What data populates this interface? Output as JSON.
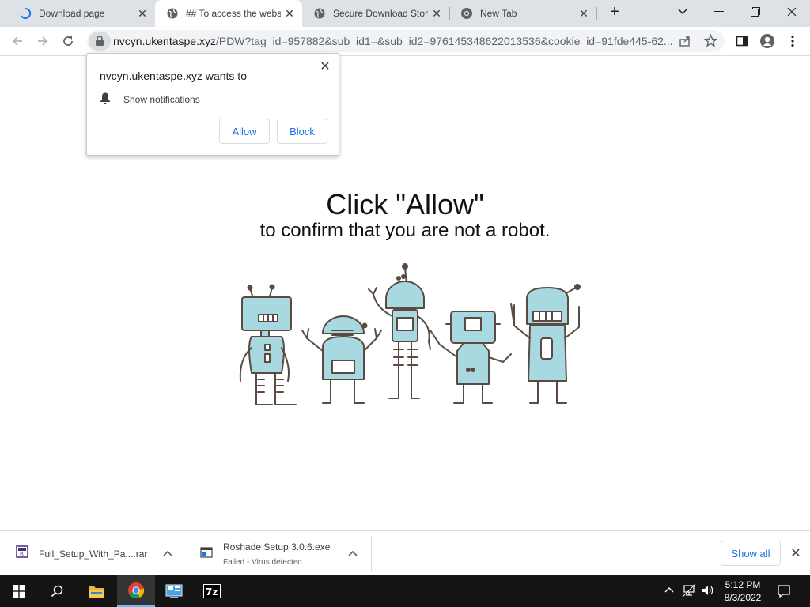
{
  "tabs": [
    {
      "title": "Download page",
      "icon": "loading-spinner-icon"
    },
    {
      "title": "## To access the websi",
      "icon": "globe-icon",
      "active": true
    },
    {
      "title": "Secure Download Store",
      "icon": "globe-icon"
    },
    {
      "title": "New Tab",
      "icon": "chrome-icon"
    }
  ],
  "toolbar": {
    "url_domain": "nvcyn.ukentaspe.xyz",
    "url_rest": "/PDW?tag_id=957882&sub_id1=&sub_id2=976145348622013536&cookie_id=91fde445-62..."
  },
  "permission": {
    "title": "nvcyn.ukentaspe.xyz wants to",
    "item": "Show notifications",
    "allow": "Allow",
    "block": "Block"
  },
  "page": {
    "headline": "Click \"Allow\"",
    "subline": "to confirm that you are not a robot."
  },
  "downloads": [
    {
      "name": "Full_Setup_With_Pa....rar",
      "status": ""
    },
    {
      "name": "Roshade Setup 3.0.6.exe",
      "status": "Failed - Virus detected"
    }
  ],
  "shelf": {
    "show_all": "Show all"
  },
  "clock": {
    "time": "5:12 PM",
    "date": "8/3/2022"
  },
  "colors": {
    "accent": "#1a73e8",
    "robot": "#a8d8e0",
    "robot_outline": "#5a4a42"
  }
}
